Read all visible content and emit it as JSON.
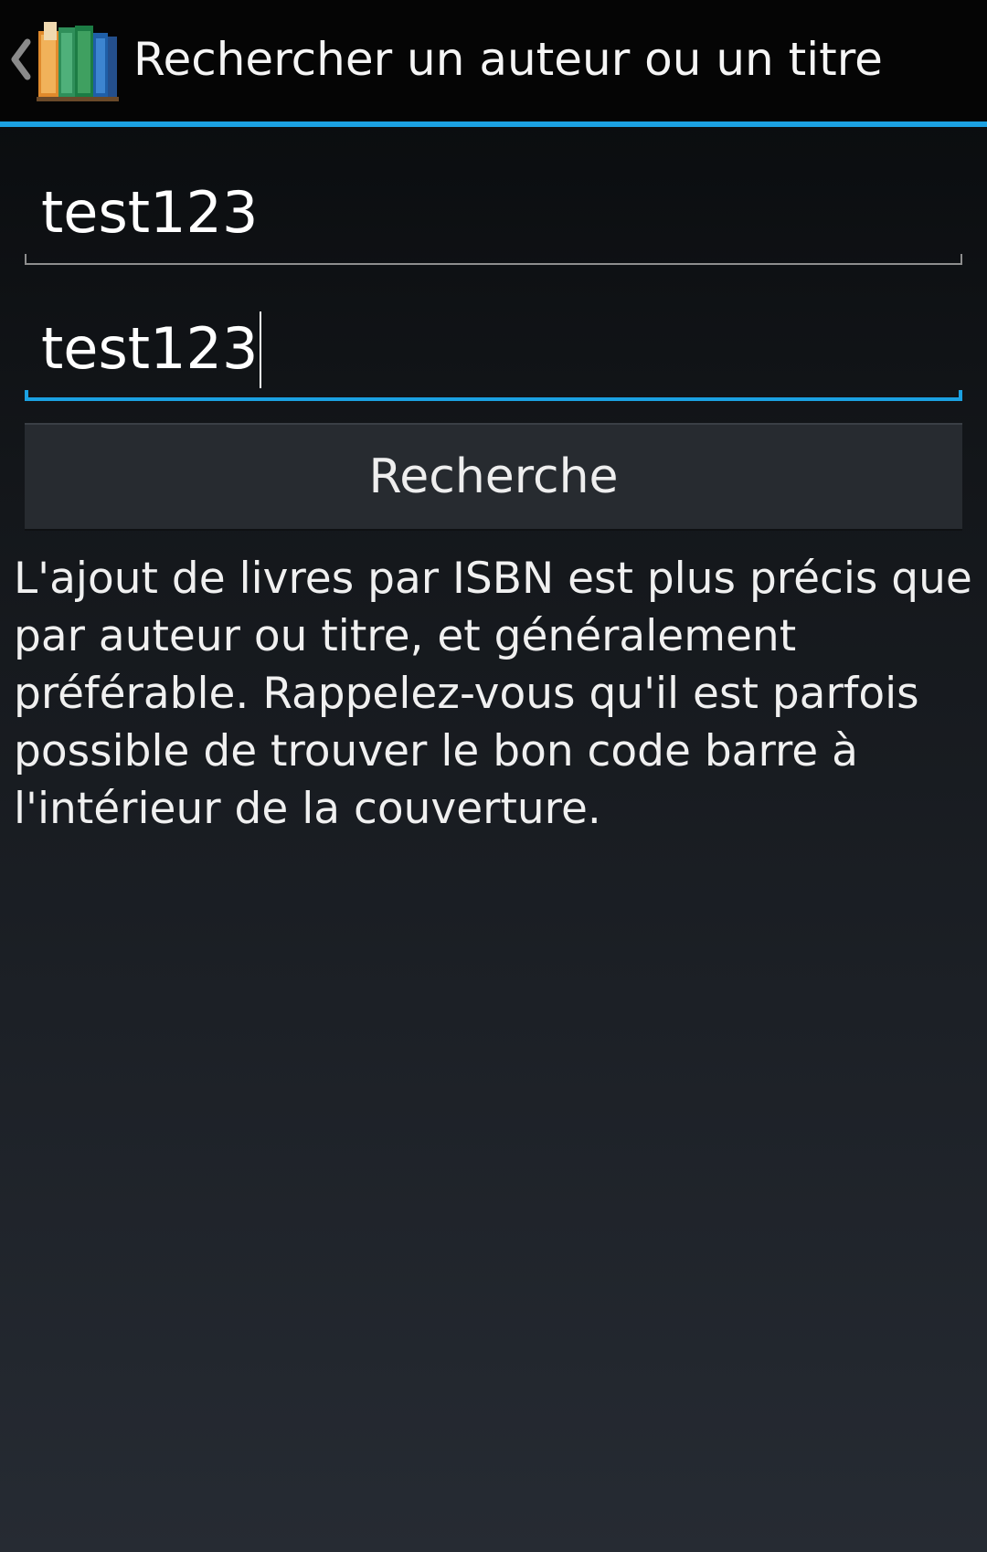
{
  "action_bar": {
    "title": "Rechercher un auteur ou un titre",
    "up_icon": "chevron-left-icon",
    "app_icon": "bookshelf-icon",
    "accent_color": "#1ba1e2"
  },
  "form": {
    "author_value": "test123",
    "title_value": "test123",
    "search_button_label": "Recherche"
  },
  "help": {
    "text": "L'ajout de livres par ISBN est plus précis que par auteur ou titre, et généralement préférable. Rappelez-vous qu'il est parfois possible de trouver le bon code barre à l'intérieur de la couverture."
  }
}
